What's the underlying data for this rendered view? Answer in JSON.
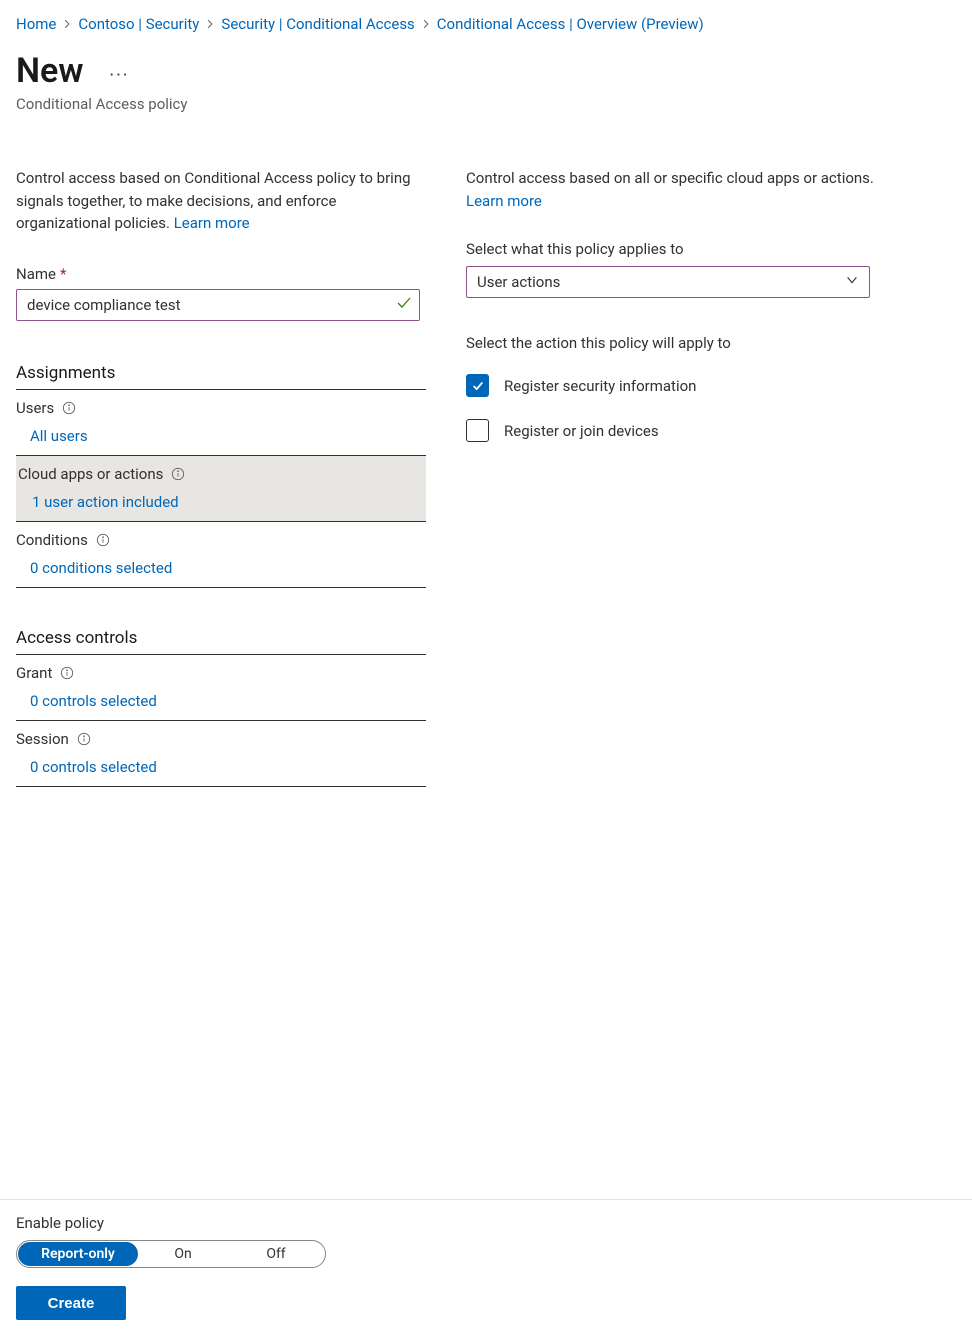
{
  "breadcrumb": {
    "items": [
      {
        "label": "Home"
      },
      {
        "label": "Contoso | Security"
      },
      {
        "label": "Security | Conditional Access"
      },
      {
        "label": "Conditional Access | Overview (Preview)"
      }
    ]
  },
  "header": {
    "title": "New",
    "subtitle": "Conditional Access policy"
  },
  "left": {
    "intro": "Control access based on Conditional Access policy to bring signals together, to make decisions, and enforce organizational policies.",
    "learn_more": "Learn more",
    "name_label": "Name",
    "name_value": "device compliance test",
    "sections": {
      "assignments": {
        "heading": "Assignments",
        "users": {
          "label": "Users",
          "value": "All users"
        },
        "cloud_apps": {
          "label": "Cloud apps or actions",
          "value": "1 user action included"
        },
        "conditions": {
          "label": "Conditions",
          "value": "0 conditions selected"
        }
      },
      "access_controls": {
        "heading": "Access controls",
        "grant": {
          "label": "Grant",
          "value": "0 controls selected"
        },
        "session": {
          "label": "Session",
          "value": "0 controls selected"
        }
      }
    }
  },
  "right": {
    "intro": "Control access based on all or specific cloud apps or actions.",
    "learn_more": "Learn more",
    "applies_label": "Select what this policy applies to",
    "applies_value": "User actions",
    "action_label": "Select the action this policy will apply to",
    "options": {
      "register_security": {
        "label": "Register security information",
        "checked": true
      },
      "register_devices": {
        "label": "Register or join devices",
        "checked": false
      }
    }
  },
  "footer": {
    "enable_label": "Enable policy",
    "toggle": {
      "options": [
        "Report-only",
        "On",
        "Off"
      ],
      "selected": "Report-only"
    },
    "create_label": "Create"
  }
}
